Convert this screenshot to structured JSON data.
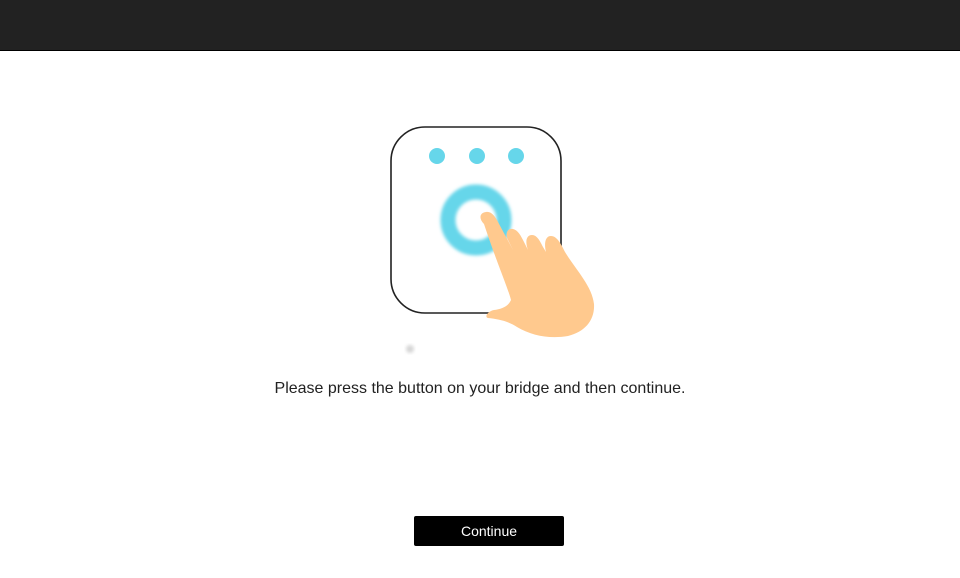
{
  "header": {
    "background": "#222222"
  },
  "illustration": {
    "icon": "press-bridge-button-icon",
    "accent_color": "#66D6EA",
    "hand_color": "#FFC98E"
  },
  "instruction": {
    "text": "Please press the button on your bridge and then continue."
  },
  "actions": {
    "continue_label": "Continue"
  }
}
